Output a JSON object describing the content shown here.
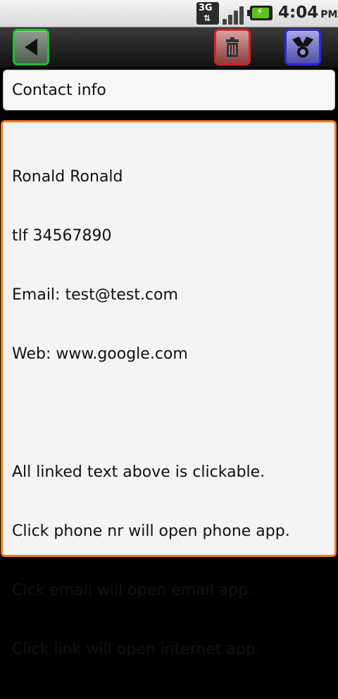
{
  "status_bar": {
    "network": "3G",
    "time": "4:04",
    "ampm": "PM"
  },
  "toolbar": {
    "back_icon": "back-arrow-icon",
    "delete_icon": "trash-icon",
    "share_icon": "share-icon"
  },
  "title": "Contact info",
  "contact": {
    "name": "Ronald Ronald",
    "phone": "tlf 34567890",
    "email": "Email: test@test.com",
    "web": "Web: www.google.com"
  },
  "notes": [
    "All linked text above is clickable.",
    "Click phone nr will open phone app.",
    "Cick email will open email app.",
    "Click link will open internet app."
  ],
  "colors": {
    "content_border": "#f57e14",
    "back_border": "#1fbf2a",
    "delete_border": "#d52525",
    "share_border": "#2a2ad6"
  }
}
